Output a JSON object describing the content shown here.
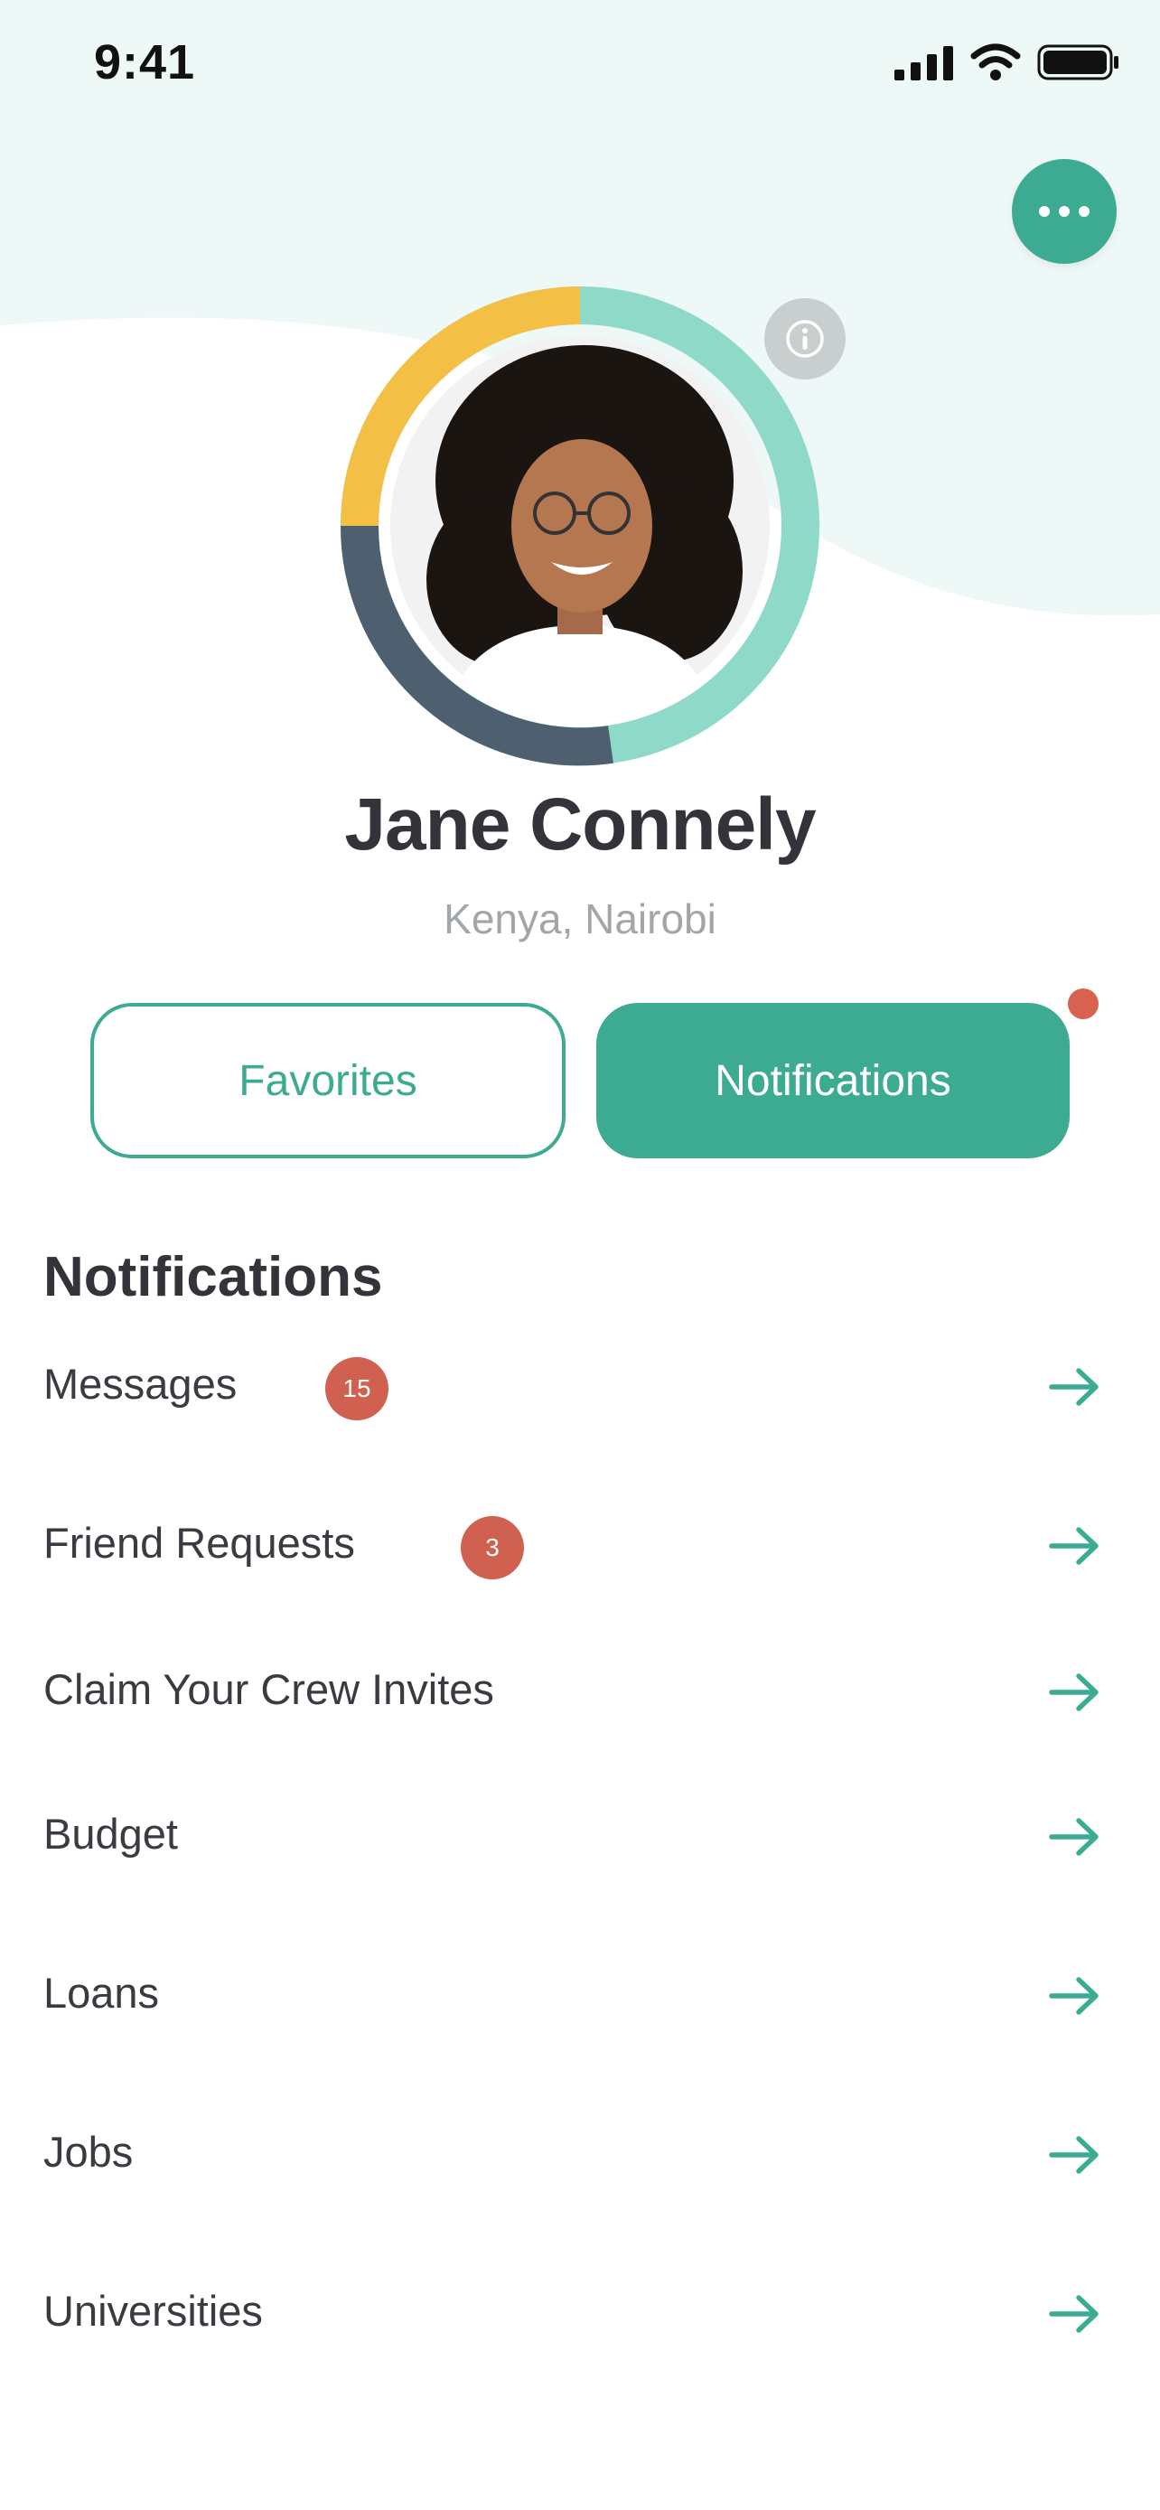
{
  "status_bar": {
    "time": "9:41"
  },
  "profile": {
    "name": "Jane Connely",
    "location": "Kenya, Nairobi"
  },
  "tabs": [
    {
      "label": "Favorites",
      "active": false
    },
    {
      "label": "Notifications",
      "active": true
    }
  ],
  "section": {
    "title": "Notifications"
  },
  "items": [
    {
      "label": "Messages",
      "badge": "15"
    },
    {
      "label": "Friend Requests",
      "badge": "3"
    },
    {
      "label": "Claim Your Crew Invites"
    },
    {
      "label": "Budget"
    },
    {
      "label": "Loans"
    },
    {
      "label": "Jobs"
    },
    {
      "label": "Universities"
    }
  ],
  "colors": {
    "accent": "#3daa92",
    "ring_light": "#8ed9c8",
    "ring_yellow": "#f3bf45",
    "ring_dark": "#4e5f6f",
    "badge_red": "#d0604f",
    "header_bg": "#eef8f7"
  }
}
